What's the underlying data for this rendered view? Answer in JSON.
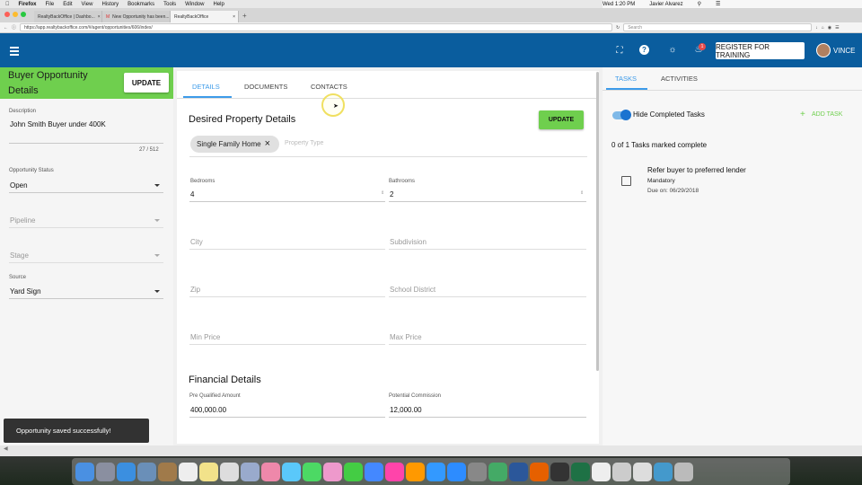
{
  "os_menu": {
    "apple": "",
    "items": [
      "Firefox",
      "File",
      "Edit",
      "View",
      "History",
      "Bookmarks",
      "Tools",
      "Window",
      "Help"
    ],
    "clock": "Wed 1:20 PM",
    "user": "Javier Alvarez"
  },
  "browser": {
    "tabs": [
      {
        "label": "RealtyBackOffice | Dashbo..."
      },
      {
        "label": "New Opportunity has been..."
      },
      {
        "label": "RealtyBackOffice"
      }
    ],
    "url": "https://app.realtybackoffice.com/#/agent/opportunities/606/index/",
    "search_placeholder": "Search"
  },
  "appbar": {
    "register_label": "REGISTER FOR TRAINING",
    "notification_count": "1",
    "user_name": "VINCE",
    "color": "#0a5d9e"
  },
  "left_panel": {
    "title": "Buyer Opportunity Details",
    "update_label": "UPDATE",
    "description_label": "Description",
    "description_value": "John Smith Buyer under 400K",
    "char_count": "27 / 512",
    "status_label": "Opportunity Status",
    "status_value": "Open",
    "pipeline_placeholder": "Pipeline",
    "stage_placeholder": "Stage",
    "source_label": "Source",
    "source_value": "Yard Sign",
    "accent": "#6fcf4e"
  },
  "main": {
    "tabs": [
      {
        "label": "DETAILS"
      },
      {
        "label": "DOCUMENTS"
      },
      {
        "label": "CONTACTS"
      }
    ],
    "section_title": "Desired Property Details",
    "update_label": "UPDATE",
    "chip_label": "Single Family Home",
    "property_type_placeholder": "Property Type",
    "bedrooms_label": "Bedrooms",
    "bedrooms_value": "4",
    "bathrooms_label": "Bathrooms",
    "bathrooms_value": "2",
    "city_placeholder": "City",
    "subdivision_placeholder": "Subdivision",
    "zip_placeholder": "Zip",
    "school_placeholder": "School District",
    "min_price_placeholder": "Min Price",
    "max_price_placeholder": "Max Price",
    "financial_title": "Financial Details",
    "prequal_label": "Pre Qualified Amount",
    "prequal_value": "400,000.00",
    "commission_label": "Potential Commission",
    "commission_value": "12,000.00"
  },
  "right_panel": {
    "tabs": [
      {
        "label": "TASKS"
      },
      {
        "label": "ACTIVITIES"
      }
    ],
    "hide_completed_label": "Hide Completed Tasks",
    "add_task_label": "ADD TASK",
    "summary": "0 of 1 Tasks marked complete",
    "task_title": "Refer buyer to preferred lender",
    "task_type": "Mandatory",
    "task_due": "Due on: 06/29/2018"
  },
  "toast": "Opportunity saved successfully!"
}
